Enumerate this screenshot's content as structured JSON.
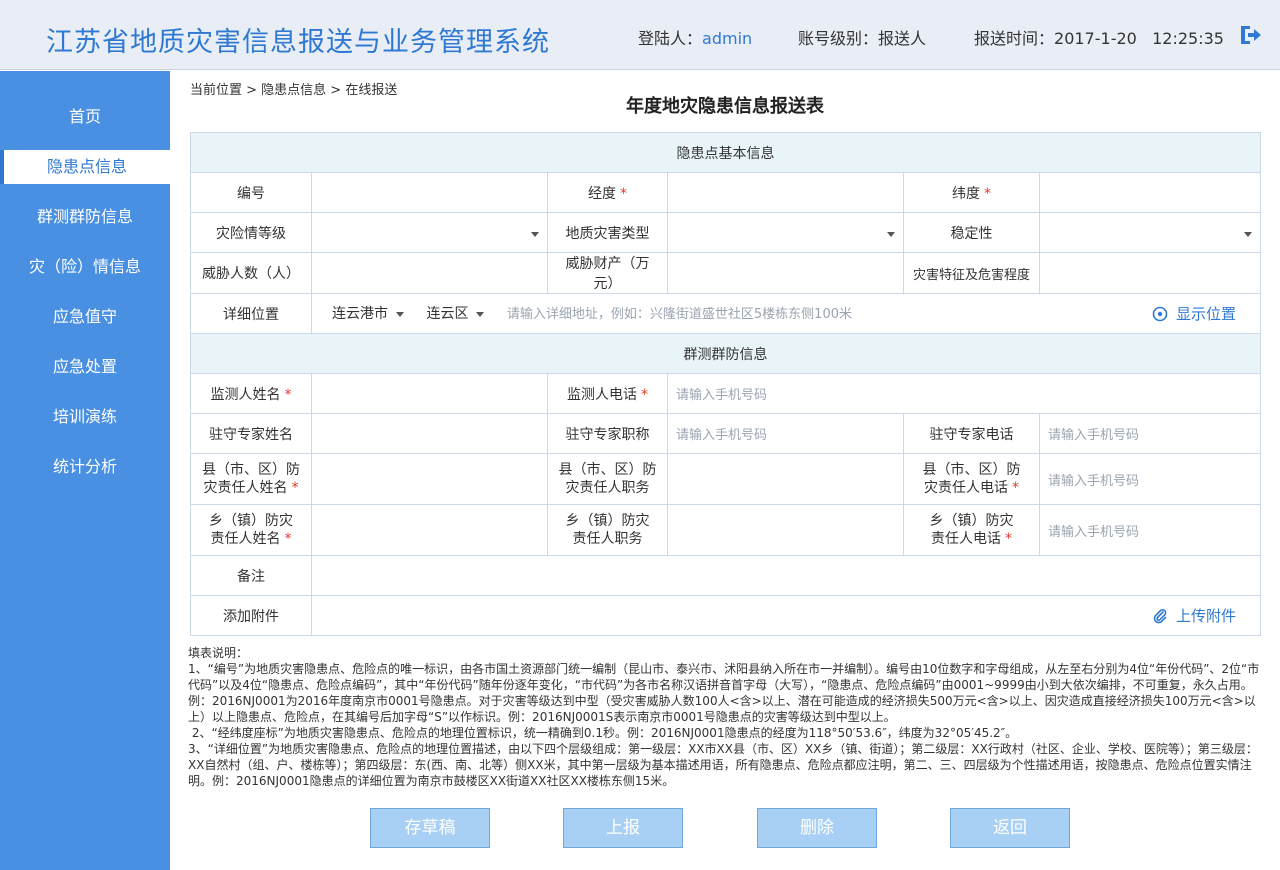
{
  "header": {
    "app_title": "江苏省地质灾害信息报送与业务管理系统",
    "user_label": "登陆人：",
    "user_value": "admin",
    "level_label": "账号级别：",
    "level_value": "报送人",
    "time_label": "报送时间：",
    "time_value": "2017-1-20   12:25:35",
    "logout_icon": "logout-icon"
  },
  "sidebar": {
    "items": [
      {
        "label": "首页"
      },
      {
        "label": "隐患点信息"
      },
      {
        "label": "群测群防信息"
      },
      {
        "label": "灾（险）情信息"
      },
      {
        "label": "应急值守"
      },
      {
        "label": "应急处置"
      },
      {
        "label": "培训演练"
      },
      {
        "label": "统计分析"
      }
    ]
  },
  "breadcrumb": "当前位置 > 隐患点信息 > 在线报送",
  "page_title": "年度地灾隐患信息报送表",
  "form": {
    "section_basic": "隐患点基本信息",
    "section_mass": "群测群防信息",
    "number": "编号",
    "longitude": "经度",
    "latitude": "纬度",
    "danger_level": "灾险情等级",
    "hazard_type": "地质灾害类型",
    "stability": "稳定性",
    "threatened_people": "威胁人数（人）",
    "threatened_property": "威胁财产（万元）",
    "hazard_feature": "灾害特征及危害程度",
    "detail_location": "详细位置",
    "city_value": "连云港市",
    "district_value": "连云区",
    "address_placeholder": "请输入详细地址，例如：兴隆街道盛世社区5楼栋东侧100米",
    "show_location": "显示位置",
    "monitor_name": "监测人姓名",
    "monitor_phone": "监测人电话",
    "phone_placeholder": "请输入手机号码",
    "expert_name": "驻守专家姓名",
    "expert_title": "驻守专家职称",
    "expert_phone": "驻守专家电话",
    "county_name_1": "县（市、区）防",
    "county_name_2": "灾责任人姓名",
    "county_duty_1": "县（市、区）防",
    "county_duty_2": "灾责任人职务",
    "county_phone_1": "县（市、区）防",
    "county_phone_2": "灾责任人电话",
    "town_name_1": "乡（镇）防灾",
    "town_name_2": "责任人姓名",
    "town_duty_1": "乡（镇）防灾",
    "town_duty_2": "责任人职务",
    "town_phone_1": "乡（镇）防灾",
    "town_phone_2": "责任人电话",
    "remark": "备注",
    "attachment": "添加附件",
    "upload": "上传附件",
    "required_mark": "*"
  },
  "notes": [
    "填表说明：",
    "1、“编号”为地质灾害隐患点、危险点的唯一标识，由各市国土资源部门统一编制（昆山市、泰兴市、沭阳县纳入所在市一并编制）。编号由10位数字和字母组成，从左至右分别为4位“年份代码”、2位“市代码”以及4位“隐患点、危险点编码”，其中“年份代码”随年份逐年变化，“市代码”为各市名称汉语拼音首字母（大写），“隐患点、危险点编码”由0001~9999由小到大依次编排，不可重复，永久占用。例：2016NJ0001为2016年度南京市0001号隐患点。对于灾害等级达到中型（受灾害威胁人数100人<含>以上、潜在可能造成的经济损失500万元<含>以上、因灾造成直接经济损失100万元<含>以上）以上隐患点、危险点，在其编号后加字母“S”以作标识。例：2016NJ0001S表示南京市0001号隐患点的灾害等级达到中型以上。",
    " 2、“经纬度座标”为地质灾害隐患点、危险点的地理位置标识，统一精确到0.1秒。例：2016NJ0001隐患点的经度为118°50′53.6″，纬度为32°05′45.2″。",
    "3、“详细位置”为地质灾害隐患点、危险点的地理位置描述，由以下四个层级组成：第一级层：XX市XX县（市、区）XX乡（镇、街道）；第二级层：XX行政村（社区、企业、学校、医院等）；第三级层：XX自然村（组、户、楼栋等）；第四级层：东(西、南、北等）侧XX米，其中第一层级为基本描述用语，所有隐患点、危险点都应注明，第二、三、四层级为个性描述用语，按隐患点、危险点位置实情注明。例：2016NJ0001隐患点的详细位置为南京市鼓楼区XX街道XX社区XX楼栋东侧15米。"
  ],
  "buttons": {
    "draft": "存草稿",
    "submit": "上报",
    "delete": "删除",
    "back": "返回"
  }
}
